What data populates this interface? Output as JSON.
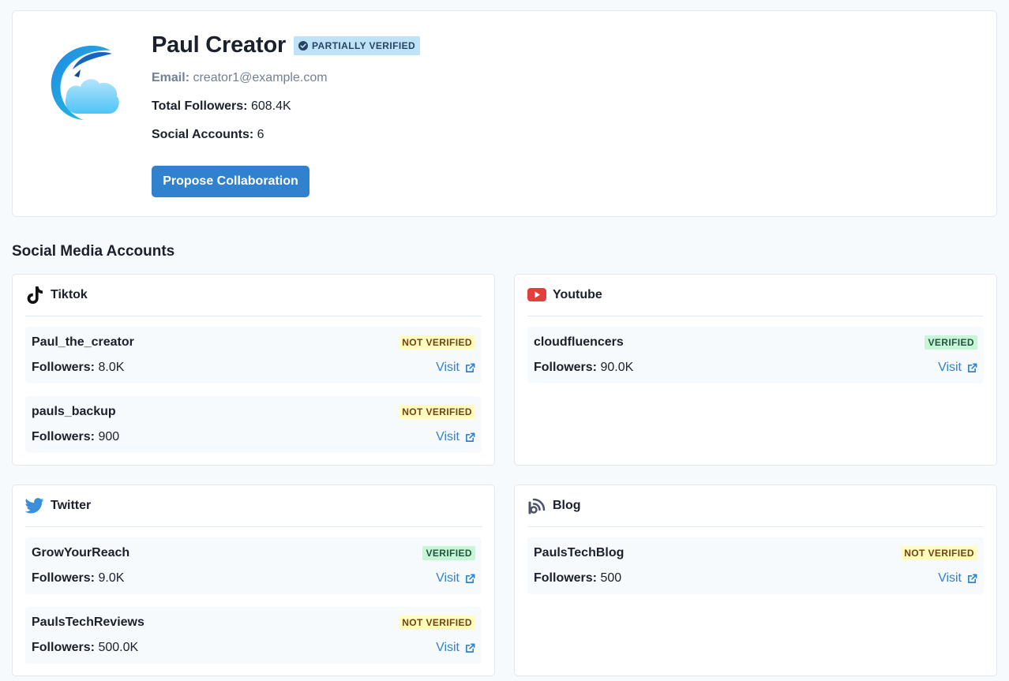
{
  "profile": {
    "name": "Paul Creator",
    "verification_badge": "PARTIALLY VERIFIED",
    "email_label": "Email:",
    "email": "creator1@example.com",
    "followers_label": "Total Followers:",
    "followers": "608.4K",
    "accounts_label": "Social Accounts:",
    "accounts": "6",
    "propose_button": "Propose Collaboration"
  },
  "section_title": "Social Media Accounts",
  "platforms": [
    {
      "name": "Tiktok",
      "icon": "tiktok-icon",
      "accounts": [
        {
          "handle": "Paul_the_creator",
          "status": "NOT VERIFIED",
          "followers_label": "Followers:",
          "followers": "8.0K",
          "visit": "Visit"
        },
        {
          "handle": "pauls_backup",
          "status": "NOT VERIFIED",
          "followers_label": "Followers:",
          "followers": "900",
          "visit": "Visit"
        }
      ]
    },
    {
      "name": "Youtube",
      "icon": "youtube-icon",
      "accounts": [
        {
          "handle": "cloudfluencers",
          "status": "VERIFIED",
          "followers_label": "Followers:",
          "followers": "90.0K",
          "visit": "Visit"
        }
      ]
    },
    {
      "name": "Twitter",
      "icon": "twitter-icon",
      "accounts": [
        {
          "handle": "GrowYourReach",
          "status": "VERIFIED",
          "followers_label": "Followers:",
          "followers": "9.0K",
          "visit": "Visit"
        },
        {
          "handle": "PaulsTechReviews",
          "status": "NOT VERIFIED",
          "followers_label": "Followers:",
          "followers": "500.0K",
          "visit": "Visit"
        }
      ]
    },
    {
      "name": "Blog",
      "icon": "blog-icon",
      "accounts": [
        {
          "handle": "PaulsTechBlog",
          "status": "NOT VERIFIED",
          "followers_label": "Followers:",
          "followers": "500",
          "visit": "Visit"
        }
      ]
    }
  ],
  "colors": {
    "accent": "#3182ce",
    "verified_bg": "#c6f6d5",
    "not_verified_bg": "#fefcbf",
    "partial_bg": "#bee3f8"
  }
}
